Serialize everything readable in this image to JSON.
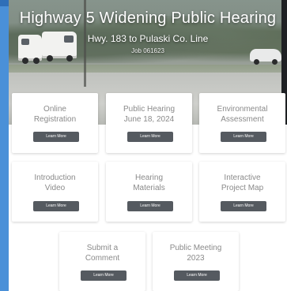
{
  "hero": {
    "title": "Highway 5 Widening Public Hearing",
    "subtitle": "Hwy. 183 to Pulaski Co. Line",
    "job": "Job 061623"
  },
  "cards": [
    {
      "title": "Online\nRegistration",
      "button": "Learn More"
    },
    {
      "title": "Public Hearing\nJune 18, 2024",
      "button": "Learn More"
    },
    {
      "title": "Environmental\nAssessment",
      "button": "Learn More"
    },
    {
      "title": "Introduction\nVideo",
      "button": "Learn More"
    },
    {
      "title": "Hearing\nMaterials",
      "button": "Learn More"
    },
    {
      "title": "Interactive\nProject Map",
      "button": "Learn More"
    },
    {
      "title": "Submit a\nComment",
      "button": "Learn More"
    },
    {
      "title": "Public Meeting\n2023",
      "button": "Learn More"
    }
  ]
}
